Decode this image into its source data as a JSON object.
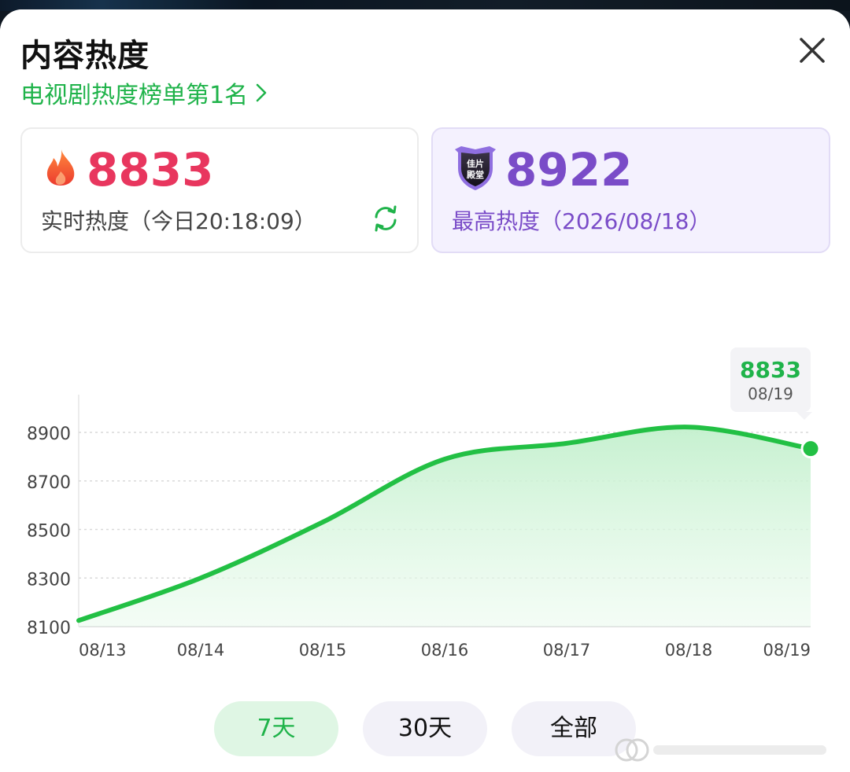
{
  "header": {
    "title": "内容热度",
    "rank_link": "电视剧热度榜单第1名"
  },
  "live_card": {
    "value": "8833",
    "label": "实时热度（今日20:18:09）"
  },
  "peak_card": {
    "value": "8922",
    "label": "最高热度（2026/08/18）",
    "badge_text": "佳片殿堂"
  },
  "tooltip": {
    "value": "8833",
    "date": "08/19"
  },
  "range_buttons": {
    "d7": "7天",
    "d30": "30天",
    "all": "全部",
    "selected": "7天"
  },
  "colors": {
    "accent_green": "#1fb34a",
    "live_red": "#e8365e",
    "peak_purple": "#7a4cc8",
    "peak_bg": "#f4f1fe",
    "fill_green": "#cdf3d6"
  },
  "chart_data": {
    "type": "area",
    "categories": [
      "08/13",
      "08/14",
      "08/15",
      "08/16",
      "08/17",
      "08/18",
      "08/19"
    ],
    "values": [
      8125,
      8300,
      8530,
      8790,
      8855,
      8922,
      8833
    ],
    "y_ticks": [
      "8900",
      "8700",
      "8500",
      "8300",
      "8100"
    ],
    "ylim": [
      8100,
      8980
    ],
    "grid": true,
    "highlight_index": 6
  }
}
